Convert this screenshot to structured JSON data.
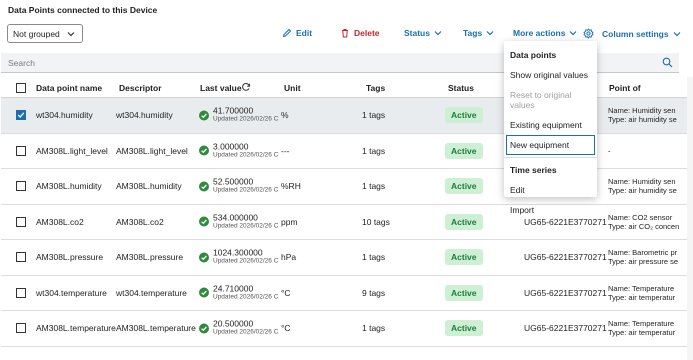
{
  "page": {
    "title": "Data Points connected to this Device"
  },
  "toolbar": {
    "grouping": "Not grouped",
    "edit_label": "Edit",
    "delete_label": "Delete",
    "status_label": "Status",
    "tags_label": "Tags",
    "more_actions_label": "More actions",
    "column_settings_label": "Column settings"
  },
  "search": {
    "placeholder": "Search"
  },
  "table": {
    "headers": [
      "Data point name",
      "Descriptor",
      "Last value",
      "Unit",
      "Tags",
      "Status",
      "Point of"
    ],
    "rows": [
      {
        "name": "wt304.humidity",
        "descriptor": "wt304.humidity",
        "value": "41.700000",
        "updated": "Updated 2026/02/26 C",
        "unit": "%",
        "tags": "1 tags",
        "status": "Active",
        "device": "",
        "poi1": "Name:  Humidity sen",
        "poi2": "Type:  air humidity se",
        "selected": true
      },
      {
        "name": "AM308L.light_level",
        "descriptor": "AM308L.light_level",
        "value": "3.000000",
        "updated": "Updated 2026/02/26 C",
        "unit": "---",
        "tags": "1 tags",
        "status": "Active",
        "device": "1",
        "poi1": "-",
        "poi2": "",
        "selected": false
      },
      {
        "name": "AM308L.humidity",
        "descriptor": "AM308L.humidity",
        "value": "52.500000",
        "updated": "Updated 2026/02/26 C",
        "unit": "%RH",
        "tags": "1 tags",
        "status": "Active",
        "device": "1",
        "poi1": "Name:  Humidity sen",
        "poi2": "Type:  air humidity se",
        "selected": false
      },
      {
        "name": "AM308L.co2",
        "descriptor": "AM308L.co2",
        "value": "534.000000",
        "updated": "Updated 2026/02/26 C",
        "unit": "ppm",
        "tags": "10 tags",
        "status": "Active",
        "device": "UG65-6221E3770271",
        "poi1": "Name:  CO2 sensor",
        "poi2": "Type:  air CO₂ concen",
        "selected": false
      },
      {
        "name": "AM308L.pressure",
        "descriptor": "AM308L.pressure",
        "value": "1024.300000",
        "updated": "Updated 2026/02/26 C",
        "unit": "hPa",
        "tags": "1 tags",
        "status": "Active",
        "device": "UG65-6221E3770271",
        "poi1": "Name:  Barometric pr",
        "poi2": "Type:  air pressure se",
        "selected": false
      },
      {
        "name": "wt304.temperature",
        "descriptor": "wt304.temperature",
        "value": "24.710000",
        "updated": "Updated 2026/02/26 C",
        "unit": "°C",
        "tags": "9 tags",
        "status": "Active",
        "device": "UG65-6221E3770271",
        "poi1": "Name:  Temperature",
        "poi2": "Type:  air temperatur",
        "selected": false
      },
      {
        "name": "AM308L.temperature",
        "descriptor": "AM308L.temperature",
        "value": "20.500000",
        "updated": "Updated 2026/02/26 C",
        "unit": "°C",
        "tags": "1 tags",
        "status": "Active",
        "device": "UG65-6221E3770271",
        "poi1": "Name:  Temperature",
        "poi2": "Type:  air temperatur",
        "selected": false
      }
    ]
  },
  "menu": {
    "section1": "Data points",
    "items1": [
      "Show original values",
      "Reset to original values",
      "Existing equipment",
      "New equipment"
    ],
    "section2": "Time series",
    "items2": [
      "Edit",
      "Import"
    ]
  },
  "colors": {
    "accent": "#1a6fb0",
    "danger": "#c0272d",
    "active_bg": "#cdf0d4",
    "active_fg": "#1f7a3a",
    "ok": "#2e8b3e"
  }
}
